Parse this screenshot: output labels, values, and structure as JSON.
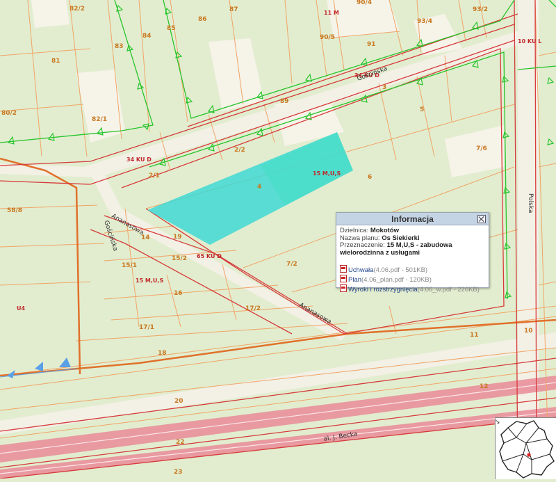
{
  "map": {
    "colors": {
      "background": "#e2edcf",
      "parcel_line": "#f0a466",
      "district_line": "#e07a2a",
      "plan_boundary": "#d63a3a",
      "plan_boundary_green": "#27c42b",
      "selected_parcel": "#3fd8d3",
      "road_pink": "#e98b98",
      "road_light": "#f4f1e8",
      "water_marks": "#5aa0e6"
    },
    "labels": {
      "p82_2": "82/2",
      "p86": "86",
      "p87": "87",
      "p11m": "11 M",
      "p90_4": "90/4",
      "p93_2": "93/2",
      "p84": "84",
      "p85": "85",
      "p90_5": "90/5",
      "p93_4": "93/4",
      "p10kul": "10 KU L",
      "p83": "83",
      "p91": "91",
      "p81": "81",
      "p34kud_top": "34 KU D",
      "p3": "3",
      "p89": "89",
      "p80_2": "80/2",
      "p82_1": "82/1",
      "p5": "5",
      "p34kud_left": "34 KU D",
      "p2_2": "2/2",
      "p7_6": "7/6",
      "p2_1": "2/1",
      "p15mus_top": "15 M,U,S",
      "p6": "6",
      "p4": "4",
      "p58_8": "58/8",
      "p14": "14",
      "p19": "19",
      "p65kud": "65 KU D",
      "p15_1": "15/1",
      "p15_2": "15/2",
      "p7_2": "7/2",
      "p15mus_bottom": "15 M,U,S",
      "p16": "16",
      "p17_2": "17/2",
      "pu4": "U4",
      "p17_1": "17/1",
      "p10": "10",
      "p11": "11",
      "p18": "18",
      "p12": "12",
      "p20": "20",
      "p22": "22",
      "p23": "23"
    },
    "streets": {
      "goscinska_top": "Gościńska",
      "goscinska_left": "Gościńska",
      "ananasowa_left": "Ananasowa",
      "ananasowa_right": "Ananasowa",
      "polska": "Polska",
      "becka": "al. J. Becka"
    }
  },
  "popup": {
    "title": "Informacja",
    "district_label": "Dzielnica:",
    "district_value": "Mokotów",
    "plan_label": "Nazwa planu:",
    "plan_value": "Os Siekierki",
    "purpose_label": "Przeznaczenie:",
    "purpose_value_line1": "15 M,U,S - zabudowa",
    "purpose_value_line2": "wielorodzinna z usługami",
    "documents": [
      {
        "name": "Uchwała",
        "meta": "(4.06.pdf - 501KB)"
      },
      {
        "name": "Plan",
        "meta": "(4.06_plan.pdf - 120KB)"
      },
      {
        "name": "Wyroki i rozstrzygnięcia",
        "meta": "(4.06_w.pdf - 226KB)"
      }
    ],
    "close_icon": "close-icon",
    "pdf_icon": "pdf-icon"
  },
  "minimap": {
    "arrow_icon": "arrow-icon",
    "arrow_glyph": "↘",
    "marker_color": "#e32020"
  }
}
